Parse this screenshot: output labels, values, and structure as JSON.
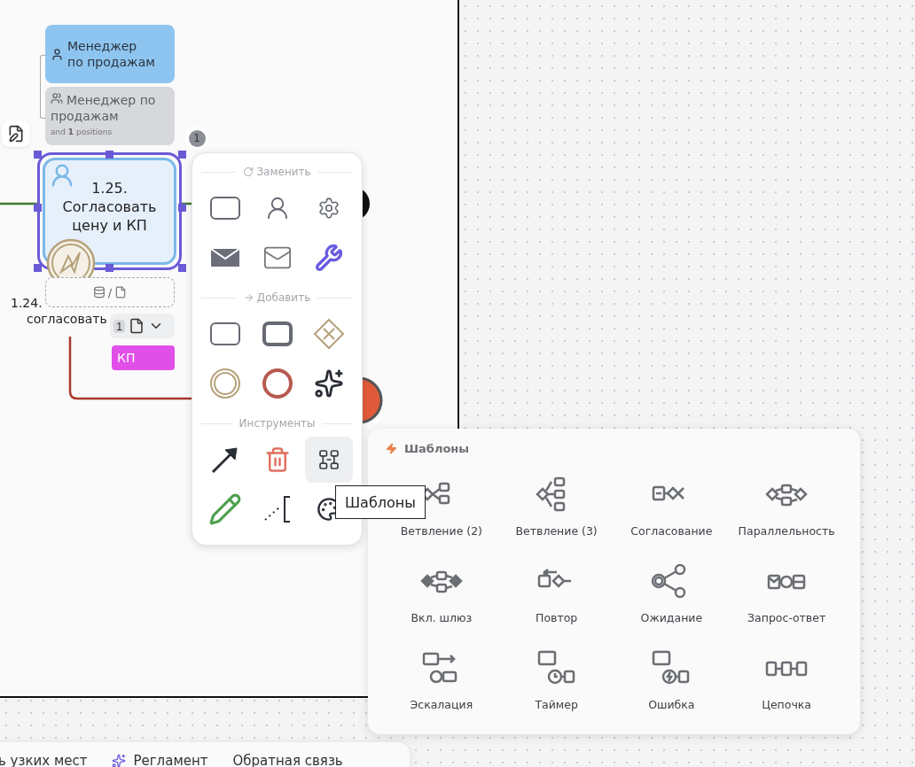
{
  "lanes": [
    {
      "kind": "role",
      "label": "Менеджер по продажам"
    },
    {
      "kind": "group",
      "label": "Менеджер по продажам",
      "note": "and **1** positions"
    }
  ],
  "task": {
    "label": "1.25. Согласовать цену и КП",
    "selected": true,
    "badge": "1"
  },
  "data_field": {
    "separator": "/"
  },
  "prev_task_label": [
    "1.24.",
    "согласовать"
  ],
  "doc_chip": {
    "count": "1"
  },
  "tag": {
    "label": "КП",
    "color": "#e04fe8"
  },
  "context_menu": {
    "sections": [
      {
        "kind": "replace",
        "title": "Заменить",
        "items": [
          {
            "kind": "task",
            "selected": false
          },
          {
            "kind": "user",
            "selected": false
          },
          {
            "kind": "service",
            "selected": false
          },
          {
            "kind": "send",
            "selected": false
          },
          {
            "kind": "receive",
            "selected": false
          },
          {
            "kind": "tool",
            "selected": false
          }
        ]
      },
      {
        "kind": "add",
        "title": "Добавить",
        "items": [
          {
            "kind": "task",
            "selected": false
          },
          {
            "kind": "subprocess",
            "selected": false
          },
          {
            "kind": "gateway",
            "selected": false
          },
          {
            "kind": "intermediate",
            "selected": false
          },
          {
            "kind": "end",
            "selected": false
          },
          {
            "kind": "ai",
            "selected": false
          }
        ]
      },
      {
        "kind": "tools",
        "title": "Инструменты",
        "items": [
          {
            "kind": "connect",
            "selected": false
          },
          {
            "kind": "delete",
            "selected": false
          },
          {
            "kind": "templates",
            "selected": true
          },
          {
            "kind": "pencil",
            "selected": false
          },
          {
            "kind": "annotation",
            "selected": false
          },
          {
            "kind": "color",
            "selected": false
          }
        ]
      }
    ]
  },
  "tooltip": "Шаблоны",
  "templates": {
    "title": "Шаблоны",
    "items": [
      {
        "kind": "branch2",
        "label": "Ветвление (2)"
      },
      {
        "kind": "branch3",
        "label": "Ветвление (3)"
      },
      {
        "kind": "approval",
        "label": "Согласование"
      },
      {
        "kind": "parallel",
        "label": "Параллельность"
      },
      {
        "kind": "inclusive",
        "label": "Вкл. шлюз"
      },
      {
        "kind": "loop",
        "label": "Повтор"
      },
      {
        "kind": "wait",
        "label": "Ожидание"
      },
      {
        "kind": "request",
        "label": "Запрос-ответ"
      },
      {
        "kind": "escalation",
        "label": "Эскалация"
      },
      {
        "kind": "timer",
        "label": "Таймер"
      },
      {
        "kind": "error",
        "label": "Ошибка"
      },
      {
        "kind": "chain",
        "label": "Цепочка"
      }
    ]
  },
  "bottom_bar": {
    "items": [
      {
        "kind": "text",
        "label": "ь узких мест"
      },
      {
        "kind": "sparkle",
        "label": "Регламент"
      },
      {
        "kind": "text",
        "label": "Обратная связь"
      }
    ]
  }
}
